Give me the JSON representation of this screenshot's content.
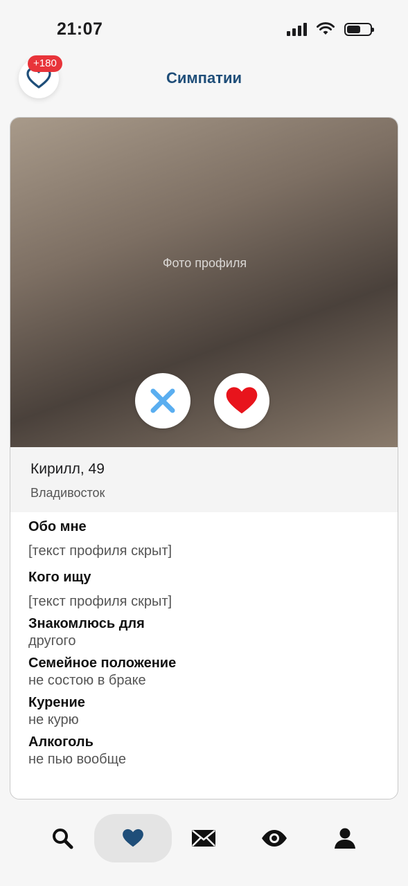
{
  "status_bar": {
    "time": "21:07"
  },
  "header": {
    "title": "Симпатии",
    "likes_badge": "+180"
  },
  "profile": {
    "photo_alt": "Фото профиля",
    "name_age": "Кирилл, 49",
    "city": "Владивосток",
    "sections": {
      "about_title": "Обо мне",
      "about_text": "[текст профиля скрыт]",
      "looking_title": "Кого ищу",
      "looking_text": "[текст профиля скрыт]",
      "purpose_title": "Знакомлюсь для",
      "purpose_value": "другого",
      "marital_title": "Семейное положение",
      "marital_value": "не состою в браке",
      "smoking_title": "Курение",
      "smoking_value": "не курю",
      "alcohol_title": "Алкоголь",
      "alcohol_value": "не пью вообще"
    }
  },
  "colors": {
    "accent": "#1f4e79",
    "badge": "#e8343a",
    "like": "#e8141c",
    "dislike": "#5aaef0"
  },
  "nav": {
    "items": [
      "search-icon",
      "heart-icon",
      "envelope-icon",
      "eye-icon",
      "user-icon"
    ],
    "active": "heart-icon"
  }
}
